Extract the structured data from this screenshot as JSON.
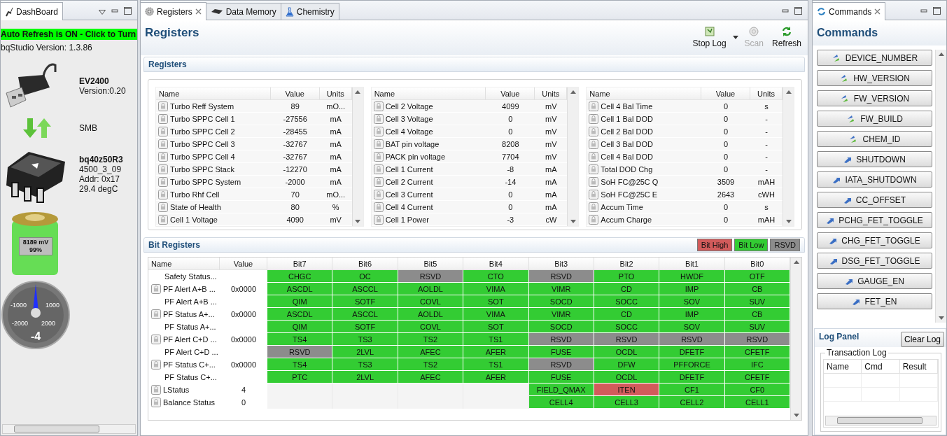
{
  "dashboard": {
    "tab": {
      "label": "DashBoard",
      "selected": true
    },
    "auto_refresh": "Auto Refresh is ON - Click to Turn",
    "version_label": "bqStudio Version:",
    "version": "1.3.86",
    "adapter": {
      "name": "EV2400",
      "version": "Version:0.20"
    },
    "bus": "SMB",
    "device": {
      "name": "bq40z50R3",
      "firmware": "4500_3_09",
      "address": "Addr: 0x17",
      "temperature": "29.4 degC"
    },
    "battery": {
      "voltage": "8189 mV",
      "charge": "99%",
      "level": 0.99
    },
    "gauge": {
      "ticks": [
        "-1000",
        "1000",
        "-2000",
        "2000"
      ],
      "value": "-4"
    }
  },
  "editor": {
    "tabs": [
      {
        "label": "Registers",
        "selected": true,
        "kind": "gear"
      },
      {
        "label": "Data Memory",
        "selected": false,
        "kind": "chip"
      },
      {
        "label": "Chemistry",
        "selected": false,
        "kind": "flask"
      }
    ],
    "title": "Registers",
    "toolbar": [
      {
        "label": "Stop Log",
        "disabled": false,
        "kind": "log",
        "dropdown": true
      },
      {
        "label": "Scan",
        "disabled": true,
        "kind": "scan",
        "dropdown": false
      },
      {
        "label": "Refresh",
        "disabled": false,
        "kind": "refresh",
        "dropdown": false
      }
    ],
    "registers": {
      "title": "Registers",
      "tables": [
        {
          "columns": [
            "Name",
            "Value",
            "Units"
          ],
          "rows": [
            [
              "Turbo Reff System",
              "89",
              "mO..."
            ],
            [
              "Turbo SPPC Cell 1",
              "-27556",
              "mA"
            ],
            [
              "Turbo SPPC Cell 2",
              "-28455",
              "mA"
            ],
            [
              "Turbo SPPC Cell 3",
              "-32767",
              "mA"
            ],
            [
              "Turbo SPPC Cell 4",
              "-32767",
              "mA"
            ],
            [
              "Turbo SPPC Stack",
              "-12270",
              "mA"
            ],
            [
              "Turbo SPPC System",
              "-2000",
              "mA"
            ],
            [
              "Turbo Rhf Cell",
              "70",
              "mO..."
            ],
            [
              "State of Health",
              "80",
              "%"
            ],
            [
              "Cell 1 Voltage",
              "4090",
              "mV"
            ]
          ]
        },
        {
          "columns": [
            "Name",
            "Value",
            "Units"
          ],
          "rows": [
            [
              "Cell 2 Voltage",
              "4099",
              "mV"
            ],
            [
              "Cell 3 Voltage",
              "0",
              "mV"
            ],
            [
              "Cell 4 Voltage",
              "0",
              "mV"
            ],
            [
              "BAT pin voltage",
              "8208",
              "mV"
            ],
            [
              "PACK pin voltage",
              "7704",
              "mV"
            ],
            [
              "Cell 1 Current",
              "-8",
              "mA"
            ],
            [
              "Cell 2 Current",
              "-14",
              "mA"
            ],
            [
              "Cell 3 Current",
              "0",
              "mA"
            ],
            [
              "Cell 4 Current",
              "0",
              "mA"
            ],
            [
              "Cell 1 Power",
              "-3",
              "cW"
            ]
          ]
        },
        {
          "columns": [
            "Name",
            "Value",
            "Units"
          ],
          "rows": [
            [
              "Cell 4 Bal Time",
              "0",
              "s"
            ],
            [
              "Cell 1 Bal DOD",
              "0",
              "-"
            ],
            [
              "Cell 2 Bal DOD",
              "0",
              "-"
            ],
            [
              "Cell 3 Bal DOD",
              "0",
              "-"
            ],
            [
              "Cell 4 Bal DOD",
              "0",
              "-"
            ],
            [
              "Total DOD Chg",
              "0",
              "-"
            ],
            [
              "SoH FC@25C Q",
              "3509",
              "mAH"
            ],
            [
              "SoH FC@25C E",
              "2643",
              "cWH"
            ],
            [
              "Accum Time",
              "0",
              "s"
            ],
            [
              "Accum Charge",
              "0",
              "mAH"
            ]
          ]
        }
      ]
    },
    "bit_registers": {
      "title": "Bit Registers",
      "legend": [
        {
          "label": "Bit High",
          "color": "#d25b5b"
        },
        {
          "label": "Bit Low",
          "color": "#33cc33"
        },
        {
          "label": "RSVD",
          "color": "#8c8c8c"
        }
      ],
      "columns": [
        "Name",
        "Value",
        "Bit7",
        "Bit6",
        "Bit5",
        "Bit4",
        "Bit3",
        "Bit2",
        "Bit1",
        "Bit0"
      ],
      "rows": [
        {
          "name": "Safety Status...",
          "locked": false,
          "bits": [
            {
              "text": "CHGC",
              "color": "#33cc33"
            },
            {
              "text": "OC",
              "color": "#33cc33"
            },
            {
              "text": "RSVD",
              "color": "#8c8c8c"
            },
            {
              "text": "CTO",
              "color": "#33cc33"
            },
            {
              "text": "RSVD",
              "color": "#8c8c8c"
            },
            {
              "text": "PTO",
              "color": "#33cc33"
            },
            {
              "text": "HWDF",
              "color": "#33cc33"
            },
            {
              "text": "OTF",
              "color": "#33cc33"
            }
          ]
        },
        {
          "name": "PF Alert A+B ...",
          "locked": true,
          "value": "0x0000",
          "bits": [
            {
              "text": "ASCDL",
              "color": "#33cc33"
            },
            {
              "text": "ASCCL",
              "color": "#33cc33"
            },
            {
              "text": "AOLDL",
              "color": "#33cc33"
            },
            {
              "text": "VIMA",
              "color": "#33cc33"
            },
            {
              "text": "VIMR",
              "color": "#33cc33"
            },
            {
              "text": "CD",
              "color": "#33cc33"
            },
            {
              "text": "IMP",
              "color": "#33cc33"
            },
            {
              "text": "CB",
              "color": "#33cc33"
            }
          ]
        },
        {
          "name": "PF Alert A+B ...",
          "locked": false,
          "bits": [
            {
              "text": "QIM",
              "color": "#33cc33"
            },
            {
              "text": "SOTF",
              "color": "#33cc33"
            },
            {
              "text": "COVL",
              "color": "#33cc33"
            },
            {
              "text": "SOT",
              "color": "#33cc33"
            },
            {
              "text": "SOCD",
              "color": "#33cc33"
            },
            {
              "text": "SOCC",
              "color": "#33cc33"
            },
            {
              "text": "SOV",
              "color": "#33cc33"
            },
            {
              "text": "SUV",
              "color": "#33cc33"
            }
          ]
        },
        {
          "name": "PF Status A+...",
          "locked": true,
          "value": "0x0000",
          "bits": [
            {
              "text": "ASCDL",
              "color": "#33cc33"
            },
            {
              "text": "ASCCL",
              "color": "#33cc33"
            },
            {
              "text": "AOLDL",
              "color": "#33cc33"
            },
            {
              "text": "VIMA",
              "color": "#33cc33"
            },
            {
              "text": "VIMR",
              "color": "#33cc33"
            },
            {
              "text": "CD",
              "color": "#33cc33"
            },
            {
              "text": "IMP",
              "color": "#33cc33"
            },
            {
              "text": "CB",
              "color": "#33cc33"
            }
          ]
        },
        {
          "name": "PF Status A+...",
          "locked": false,
          "bits": [
            {
              "text": "QIM",
              "color": "#33cc33"
            },
            {
              "text": "SOTF",
              "color": "#33cc33"
            },
            {
              "text": "COVL",
              "color": "#33cc33"
            },
            {
              "text": "SOT",
              "color": "#33cc33"
            },
            {
              "text": "SOCD",
              "color": "#33cc33"
            },
            {
              "text": "SOCC",
              "color": "#33cc33"
            },
            {
              "text": "SOV",
              "color": "#33cc33"
            },
            {
              "text": "SUV",
              "color": "#33cc33"
            }
          ]
        },
        {
          "name": "PF Alert C+D ...",
          "locked": true,
          "value": "0x0000",
          "bits": [
            {
              "text": "TS4",
              "color": "#33cc33"
            },
            {
              "text": "TS3",
              "color": "#33cc33"
            },
            {
              "text": "TS2",
              "color": "#33cc33"
            },
            {
              "text": "TS1",
              "color": "#33cc33"
            },
            {
              "text": "RSVD",
              "color": "#8c8c8c"
            },
            {
              "text": "RSVD",
              "color": "#8c8c8c"
            },
            {
              "text": "RSVD",
              "color": "#8c8c8c"
            },
            {
              "text": "RSVD",
              "color": "#8c8c8c"
            }
          ]
        },
        {
          "name": "PF Alert C+D ...",
          "locked": false,
          "bits": [
            {
              "text": "RSVD",
              "color": "#8c8c8c"
            },
            {
              "text": "2LVL",
              "color": "#33cc33"
            },
            {
              "text": "AFEC",
              "color": "#33cc33"
            },
            {
              "text": "AFER",
              "color": "#33cc33"
            },
            {
              "text": "FUSE",
              "color": "#33cc33"
            },
            {
              "text": "OCDL",
              "color": "#33cc33"
            },
            {
              "text": "DFETF",
              "color": "#33cc33"
            },
            {
              "text": "CFETF",
              "color": "#33cc33"
            }
          ]
        },
        {
          "name": "PF Status C+...",
          "locked": true,
          "value": "0x0000",
          "bits": [
            {
              "text": "TS4",
              "color": "#33cc33"
            },
            {
              "text": "TS3",
              "color": "#33cc33"
            },
            {
              "text": "TS2",
              "color": "#33cc33"
            },
            {
              "text": "TS1",
              "color": "#33cc33"
            },
            {
              "text": "RSVD",
              "color": "#8c8c8c"
            },
            {
              "text": "DFW",
              "color": "#33cc33"
            },
            {
              "text": "PFFORCE",
              "color": "#33cc33"
            },
            {
              "text": "IFC",
              "color": "#33cc33"
            }
          ]
        },
        {
          "name": "PF Status C+...",
          "locked": false,
          "bits": [
            {
              "text": "PTC",
              "color": "#33cc33"
            },
            {
              "text": "2LVL",
              "color": "#33cc33"
            },
            {
              "text": "AFEC",
              "color": "#33cc33"
            },
            {
              "text": "AFER",
              "color": "#33cc33"
            },
            {
              "text": "FUSE",
              "color": "#33cc33"
            },
            {
              "text": "OCDL",
              "color": "#33cc33"
            },
            {
              "text": "DFETF",
              "color": "#33cc33"
            },
            {
              "text": "CFETF",
              "color": "#33cc33"
            }
          ]
        },
        {
          "name": "LStatus",
          "locked": true,
          "value": "4",
          "bits": [
            {
              "text": "FIELD_QMAX",
              "color": "#33cc33"
            },
            {
              "text": "ITEN",
              "color": "#d25b5b"
            },
            {
              "text": "CF1",
              "color": "#33cc33"
            },
            {
              "text": "CF0",
              "color": "#33cc33"
            }
          ]
        },
        {
          "name": "Balance Status",
          "locked": true,
          "value": "0",
          "bits": [
            {
              "text": "CELL4",
              "color": "#33cc33"
            },
            {
              "text": "CELL3",
              "color": "#33cc33"
            },
            {
              "text": "CELL2",
              "color": "#33cc33"
            },
            {
              "text": "CELL1",
              "color": "#33cc33"
            }
          ]
        }
      ]
    }
  },
  "commands": {
    "tab": {
      "label": "Commands",
      "selected": true
    },
    "title": "Commands",
    "buttons": [
      {
        "label": "DEVICE_NUMBER",
        "kind": "read"
      },
      {
        "label": "HW_VERSION",
        "kind": "read"
      },
      {
        "label": "FW_VERSION",
        "kind": "read"
      },
      {
        "label": "FW_BUILD",
        "kind": "read"
      },
      {
        "label": "CHEM_ID",
        "kind": "read"
      },
      {
        "label": "SHUTDOWN",
        "kind": "write"
      },
      {
        "label": "IATA_SHUTDOWN",
        "kind": "write"
      },
      {
        "label": "CC_OFFSET",
        "kind": "write"
      },
      {
        "label": "PCHG_FET_TOGGLE",
        "kind": "write"
      },
      {
        "label": "CHG_FET_TOGGLE",
        "kind": "write"
      },
      {
        "label": "DSG_FET_TOGGLE",
        "kind": "write"
      },
      {
        "label": "GAUGE_EN",
        "kind": "write"
      },
      {
        "label": "FET_EN",
        "kind": "write"
      }
    ],
    "log_panel": {
      "title": "Log Panel",
      "clear_button": "Clear Log",
      "group": "Transaction Log",
      "columns": [
        "Name",
        "Cmd",
        "Result"
      ]
    }
  }
}
